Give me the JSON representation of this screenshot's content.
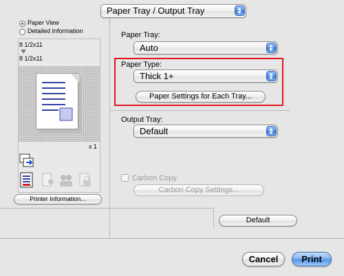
{
  "header": {
    "section_popup": "Paper Tray / Output Tray"
  },
  "sidebar": {
    "view_options": [
      {
        "label": "Paper View",
        "checked": true
      },
      {
        "label": "Detailed Information",
        "checked": false
      }
    ],
    "preview": {
      "source_size": "8 1/2x11",
      "output_size": "8 1/2x11",
      "copies": "x 1"
    },
    "printer_info_button": "Printer Information..."
  },
  "main": {
    "paper_tray": {
      "label": "Paper Tray:",
      "value": "Auto"
    },
    "paper_type": {
      "label": "Paper Type:",
      "value": "Thick 1+"
    },
    "paper_settings_button": "Paper Settings for Each Tray...",
    "output_tray": {
      "label": "Output Tray:",
      "value": "Default"
    },
    "carbon_copy": {
      "label": "Carbon Copy",
      "checked": false,
      "enabled": false
    },
    "carbon_copy_settings_button": "Carbon Copy Settings...",
    "default_button": "Default"
  },
  "footer": {
    "cancel": "Cancel",
    "print": "Print"
  },
  "colors": {
    "highlight": "#e0141c",
    "accent": "#3d7fdc"
  }
}
